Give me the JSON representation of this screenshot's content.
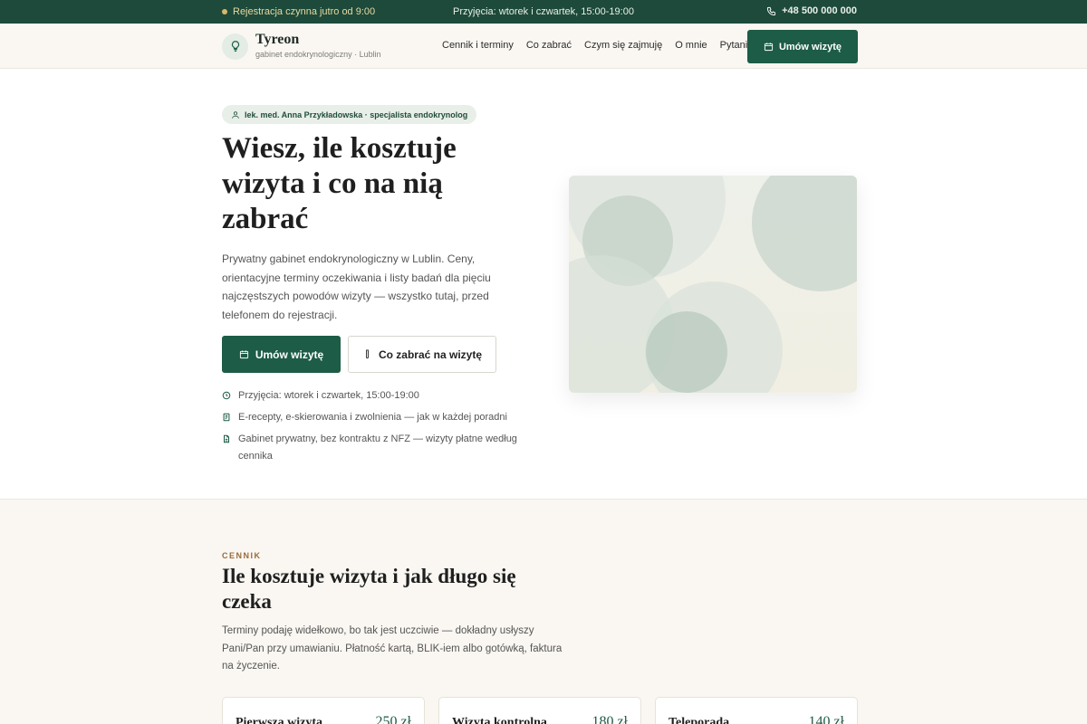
{
  "topbar": {
    "registration": "Rejestracja czynna jutro od 9:00",
    "hours": "Przyjęcia: wtorek i czwartek, 15:00-19:00",
    "phone": "+48 500 000 000"
  },
  "header": {
    "brand": "Tyreon",
    "subtitle": "gabinet endokrynologiczny · Lublin",
    "nav": [
      "Cennik i terminy",
      "Co zabrać",
      "Czym się zajmuję",
      "O mnie",
      "Pytania"
    ],
    "cta": "Umów wizytę"
  },
  "hero": {
    "badge": "lek. med. Anna Przykładowska · specjalista endokrynolog",
    "title": "Wiesz, ile kosztuje wizyta i co na nią zabrać",
    "lead": "Prywatny gabinet endokrynologiczny w Lublin. Ceny, orientacyjne terminy oczekiwania i listy badań dla pięciu najczęstszych powodów wizyty — wszystko tutaj, przed telefonem do rejestracji.",
    "primary_button": "Umów wizytę",
    "secondary_button": "Co zabrać na wizytę",
    "facts": [
      "Przyjęcia: wtorek i czwartek, 15:00-19:00",
      "E-recepty, e-skierowania i zwolnienia — jak w każdej poradni",
      "Gabinet prywatny, bez kontraktu z NFZ — wizyty płatne według cennika"
    ]
  },
  "pricing": {
    "eyebrow": "CENNIK",
    "title": "Ile kosztuje wizyta i jak długo się czeka",
    "lead": "Terminy podaję widełkowo, bo tak jest uczciwie — dokładny usłyszy Pani/Pan przy umawianiu. Płatność kartą, BLIK-iem albo gotówką, faktura na życzenie.",
    "cards": [
      {
        "name": "Pierwsza wizyta",
        "price": "250 zł"
      },
      {
        "name": "Wizyta kontrolna",
        "price": "180 zł"
      },
      {
        "name": "Teleporada",
        "price": "140 zł"
      }
    ]
  },
  "colors": {
    "brand": "#1d5c46",
    "topbar": "#1d4a3a",
    "accent": "#9a6a3a"
  },
  "icons": {
    "topbar": "phone-icon",
    "logo": "lightbulb-icon",
    "cta": "calendar-icon",
    "badge": "user-icon",
    "secondary": "test-tube-icon",
    "facts": [
      "clock-icon",
      "prescription-icon",
      "document-icon"
    ]
  }
}
